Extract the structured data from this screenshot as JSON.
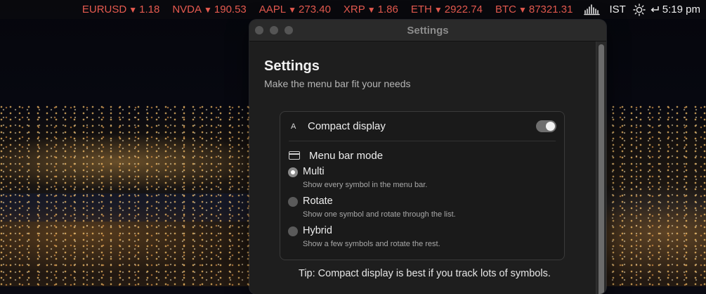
{
  "menubar": {
    "tickers": [
      {
        "symbol": "EURUSD",
        "arrow": "▼",
        "value": "1.18"
      },
      {
        "symbol": "NVDA",
        "arrow": "▼",
        "value": "190.53"
      },
      {
        "symbol": "AAPL",
        "arrow": "▼",
        "value": "273.40"
      },
      {
        "symbol": "XRP",
        "arrow": "▼",
        "value": "1.86"
      },
      {
        "symbol": "ETH",
        "arrow": "▼",
        "value": "2922.74"
      },
      {
        "symbol": "BTC",
        "arrow": "▼",
        "value": "87321.31"
      }
    ],
    "ticker_color": "#e65a4f",
    "timezone": "IST",
    "clock": "5:19 pm",
    "icons": [
      "waveform-icon",
      "brightness-icon",
      "return-arrow-icon"
    ]
  },
  "window": {
    "title": "Settings",
    "heading": "Settings",
    "subheading": "Make the menu bar fit your needs",
    "compact": {
      "glyph": "A",
      "label": "Compact display",
      "enabled": true
    },
    "mode": {
      "label": "Menu bar mode",
      "selected": "Multi",
      "options": [
        {
          "label": "Multi",
          "description": "Show every symbol in the menu bar.",
          "selected": true
        },
        {
          "label": "Rotate",
          "description": "Show one symbol and rotate through the list.",
          "selected": false
        },
        {
          "label": "Hybrid",
          "description": "Show a few symbols and rotate the rest.",
          "selected": false
        }
      ]
    },
    "tip": "Tip: Compact display is best if you track lots of symbols."
  }
}
